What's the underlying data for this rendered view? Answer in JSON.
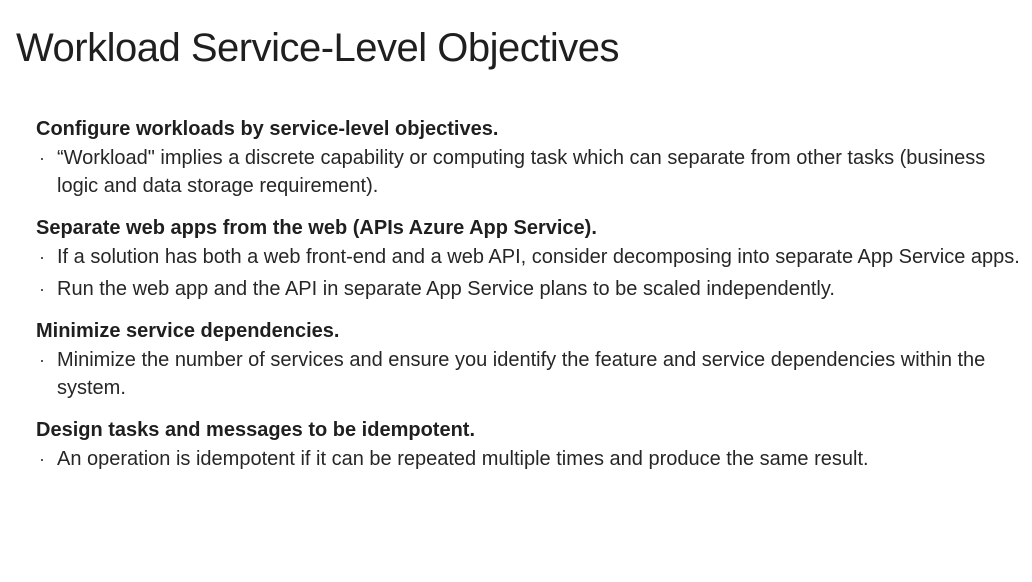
{
  "title": "Workload Service-Level Objectives",
  "sections": [
    {
      "heading": "Configure workloads by service-level objectives.",
      "bullets": [
        "“Workload\" implies a discrete capability or computing task which can separate from other tasks (business logic and data storage requirement)."
      ]
    },
    {
      "heading": "Separate web apps from the web (APIs Azure App Service).",
      "bullets": [
        "If a solution has both a web front-end and a web API, consider decomposing into separate App Service apps.",
        "Run the web app and the API in separate App Service plans to be scaled independently."
      ]
    },
    {
      "heading": "Minimize service dependencies.",
      "bullets": [
        "Minimize the number of services and ensure you identify the feature and service dependencies within the system."
      ]
    },
    {
      "heading": "Design tasks and messages to be idempotent.",
      "bullets": [
        "An operation is idempotent if it can be repeated multiple times and produce the same result."
      ]
    }
  ],
  "bullet_glyph": "·"
}
